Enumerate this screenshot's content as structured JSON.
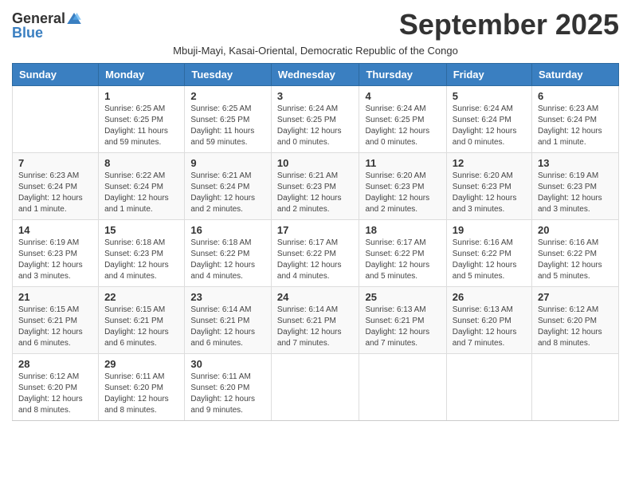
{
  "logo": {
    "general": "General",
    "blue": "Blue"
  },
  "header": {
    "month": "September 2025",
    "subtitle": "Mbuji-Mayi, Kasai-Oriental, Democratic Republic of the Congo"
  },
  "days_of_week": [
    "Sunday",
    "Monday",
    "Tuesday",
    "Wednesday",
    "Thursday",
    "Friday",
    "Saturday"
  ],
  "weeks": [
    [
      {
        "day": "",
        "info": ""
      },
      {
        "day": "1",
        "info": "Sunrise: 6:25 AM\nSunset: 6:25 PM\nDaylight: 11 hours\nand 59 minutes."
      },
      {
        "day": "2",
        "info": "Sunrise: 6:25 AM\nSunset: 6:25 PM\nDaylight: 11 hours\nand 59 minutes."
      },
      {
        "day": "3",
        "info": "Sunrise: 6:24 AM\nSunset: 6:25 PM\nDaylight: 12 hours\nand 0 minutes."
      },
      {
        "day": "4",
        "info": "Sunrise: 6:24 AM\nSunset: 6:25 PM\nDaylight: 12 hours\nand 0 minutes."
      },
      {
        "day": "5",
        "info": "Sunrise: 6:24 AM\nSunset: 6:24 PM\nDaylight: 12 hours\nand 0 minutes."
      },
      {
        "day": "6",
        "info": "Sunrise: 6:23 AM\nSunset: 6:24 PM\nDaylight: 12 hours\nand 1 minute."
      }
    ],
    [
      {
        "day": "7",
        "info": "Sunrise: 6:23 AM\nSunset: 6:24 PM\nDaylight: 12 hours\nand 1 minute."
      },
      {
        "day": "8",
        "info": "Sunrise: 6:22 AM\nSunset: 6:24 PM\nDaylight: 12 hours\nand 1 minute."
      },
      {
        "day": "9",
        "info": "Sunrise: 6:21 AM\nSunset: 6:24 PM\nDaylight: 12 hours\nand 2 minutes."
      },
      {
        "day": "10",
        "info": "Sunrise: 6:21 AM\nSunset: 6:23 PM\nDaylight: 12 hours\nand 2 minutes."
      },
      {
        "day": "11",
        "info": "Sunrise: 6:20 AM\nSunset: 6:23 PM\nDaylight: 12 hours\nand 2 minutes."
      },
      {
        "day": "12",
        "info": "Sunrise: 6:20 AM\nSunset: 6:23 PM\nDaylight: 12 hours\nand 3 minutes."
      },
      {
        "day": "13",
        "info": "Sunrise: 6:19 AM\nSunset: 6:23 PM\nDaylight: 12 hours\nand 3 minutes."
      }
    ],
    [
      {
        "day": "14",
        "info": "Sunrise: 6:19 AM\nSunset: 6:23 PM\nDaylight: 12 hours\nand 3 minutes."
      },
      {
        "day": "15",
        "info": "Sunrise: 6:18 AM\nSunset: 6:23 PM\nDaylight: 12 hours\nand 4 minutes."
      },
      {
        "day": "16",
        "info": "Sunrise: 6:18 AM\nSunset: 6:22 PM\nDaylight: 12 hours\nand 4 minutes."
      },
      {
        "day": "17",
        "info": "Sunrise: 6:17 AM\nSunset: 6:22 PM\nDaylight: 12 hours\nand 4 minutes."
      },
      {
        "day": "18",
        "info": "Sunrise: 6:17 AM\nSunset: 6:22 PM\nDaylight: 12 hours\nand 5 minutes."
      },
      {
        "day": "19",
        "info": "Sunrise: 6:16 AM\nSunset: 6:22 PM\nDaylight: 12 hours\nand 5 minutes."
      },
      {
        "day": "20",
        "info": "Sunrise: 6:16 AM\nSunset: 6:22 PM\nDaylight: 12 hours\nand 5 minutes."
      }
    ],
    [
      {
        "day": "21",
        "info": "Sunrise: 6:15 AM\nSunset: 6:21 PM\nDaylight: 12 hours\nand 6 minutes."
      },
      {
        "day": "22",
        "info": "Sunrise: 6:15 AM\nSunset: 6:21 PM\nDaylight: 12 hours\nand 6 minutes."
      },
      {
        "day": "23",
        "info": "Sunrise: 6:14 AM\nSunset: 6:21 PM\nDaylight: 12 hours\nand 6 minutes."
      },
      {
        "day": "24",
        "info": "Sunrise: 6:14 AM\nSunset: 6:21 PM\nDaylight: 12 hours\nand 7 minutes."
      },
      {
        "day": "25",
        "info": "Sunrise: 6:13 AM\nSunset: 6:21 PM\nDaylight: 12 hours\nand 7 minutes."
      },
      {
        "day": "26",
        "info": "Sunrise: 6:13 AM\nSunset: 6:20 PM\nDaylight: 12 hours\nand 7 minutes."
      },
      {
        "day": "27",
        "info": "Sunrise: 6:12 AM\nSunset: 6:20 PM\nDaylight: 12 hours\nand 8 minutes."
      }
    ],
    [
      {
        "day": "28",
        "info": "Sunrise: 6:12 AM\nSunset: 6:20 PM\nDaylight: 12 hours\nand 8 minutes."
      },
      {
        "day": "29",
        "info": "Sunrise: 6:11 AM\nSunset: 6:20 PM\nDaylight: 12 hours\nand 8 minutes."
      },
      {
        "day": "30",
        "info": "Sunrise: 6:11 AM\nSunset: 6:20 PM\nDaylight: 12 hours\nand 9 minutes."
      },
      {
        "day": "",
        "info": ""
      },
      {
        "day": "",
        "info": ""
      },
      {
        "day": "",
        "info": ""
      },
      {
        "day": "",
        "info": ""
      }
    ]
  ]
}
